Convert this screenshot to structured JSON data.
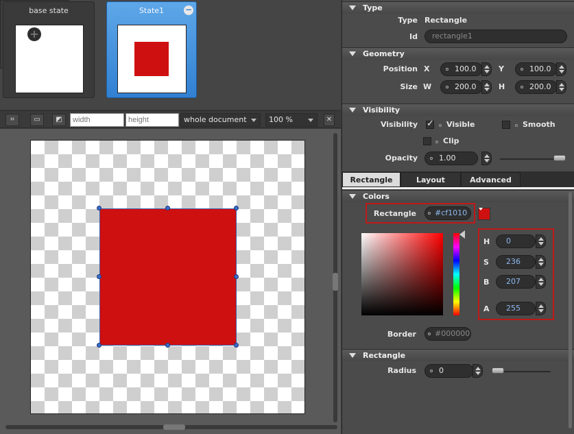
{
  "states": {
    "base_title": "base state",
    "state1_title": "State1"
  },
  "toolbar": {
    "width_placeholder": "width",
    "height_placeholder": "height",
    "scope": "whole document",
    "zoom": "100 %"
  },
  "canvas": {
    "rect_color": "#cf1010"
  },
  "inspector": {
    "type_section": "Type",
    "type_label": "Type",
    "type_value": "Rectangle",
    "id_label": "Id",
    "id_placeholder": "rectangle1",
    "geometry_section": "Geometry",
    "position_label": "Position",
    "x_label": "X",
    "x_value": "100.0",
    "y_label": "Y",
    "y_value": "100.0",
    "size_label": "Size",
    "w_label": "W",
    "w_value": "200.0",
    "h_label": "H",
    "h_value": "200.0",
    "visibility_section": "Visibility",
    "visibility_label": "Visibility",
    "visible_label": "Visible",
    "smooth_label": "Smooth",
    "clip_label": "Clip",
    "opacity_label": "Opacity",
    "opacity_value": "1.00",
    "opacity_level": 1.0,
    "tabs": [
      "Rectangle",
      "Layout",
      "Advanced"
    ],
    "colors_section": "Colors",
    "rect_color_label": "Rectangle",
    "rect_color_value": "#cf1010",
    "hsba": {
      "h_label": "H",
      "h_value": "0",
      "s_label": "S",
      "s_value": "236",
      "b_label": "B",
      "b_value": "207",
      "a_label": "A",
      "a_value": "255"
    },
    "border_label": "Border",
    "border_value": "#000000",
    "rectangle_section": "Rectangle",
    "radius_label": "Radius",
    "radius_value": "0",
    "radius_level": 0
  }
}
